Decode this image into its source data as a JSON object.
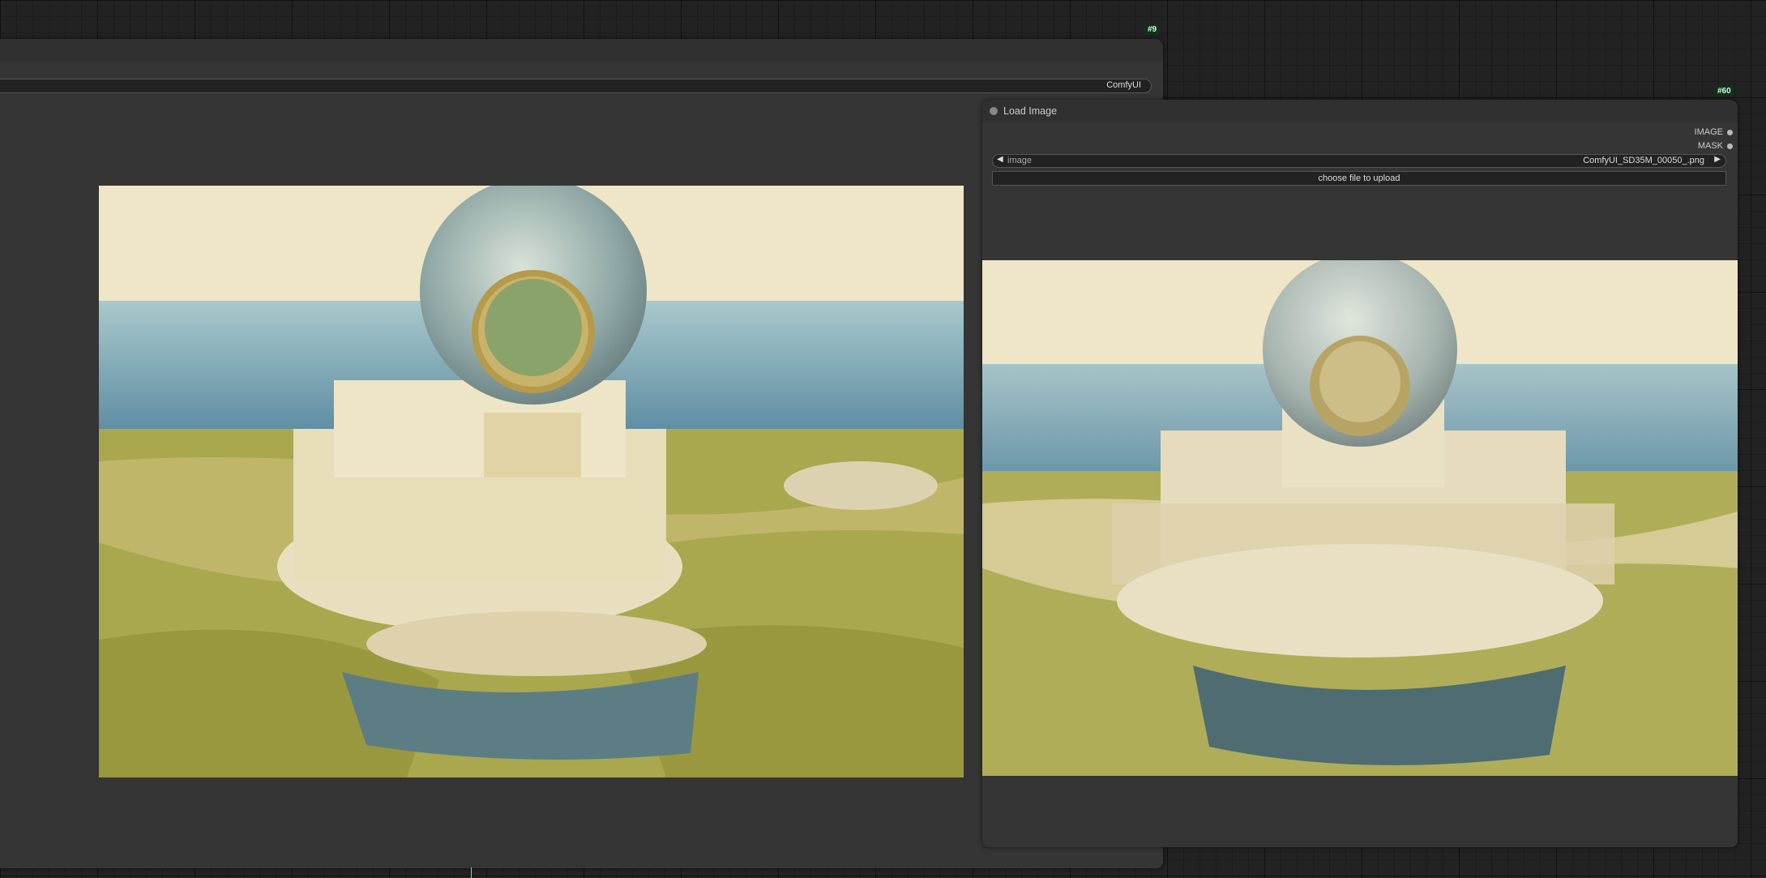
{
  "canvas": {
    "background": "#222222"
  },
  "node_save": {
    "id_badge": "#9",
    "widget_value": "ComfyUI",
    "preview_image": "generated-palace-image"
  },
  "node_load": {
    "id_badge": "#60",
    "title": "Load Image",
    "outputs": [
      "IMAGE",
      "MASK"
    ],
    "image_widget": {
      "label": "image",
      "value": "ComfyUI_SD35M_00050_.png"
    },
    "upload_button": "choose file to upload",
    "preview_image": "loaded-palace-image"
  }
}
